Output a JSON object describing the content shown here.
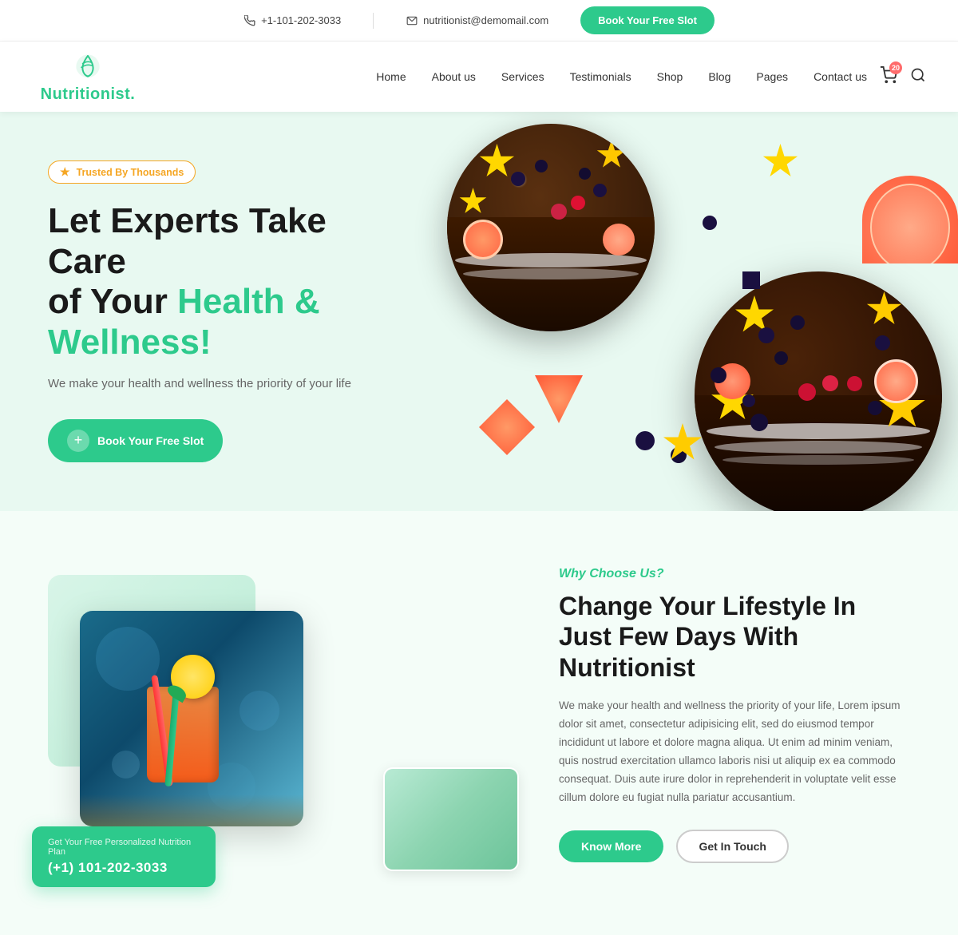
{
  "topbar": {
    "phone": "+1-101-202-3033",
    "email": "nutritionist@demomail.com",
    "book_btn": "Book Your Free Slot"
  },
  "logo": {
    "name": "Nutritionist.",
    "dot_color": "#2dca8c"
  },
  "nav": {
    "items": [
      {
        "label": "Home",
        "href": "#"
      },
      {
        "label": "About us",
        "href": "#"
      },
      {
        "label": "Services",
        "href": "#"
      },
      {
        "label": "Testimonials",
        "href": "#"
      },
      {
        "label": "Shop",
        "href": "#"
      },
      {
        "label": "Blog",
        "href": "#"
      },
      {
        "label": "Pages",
        "href": "#"
      },
      {
        "label": "Contact us",
        "href": "#"
      }
    ],
    "cart_count": "20"
  },
  "hero": {
    "badge_text": "Trusted By Thousands",
    "heading_line1": "Let Experts Take Care",
    "heading_line2_plain": "of Your ",
    "heading_line2_highlight": "Health & Wellness!",
    "subtext": "We make your health and wellness the priority of your life",
    "cta_btn": "Book Your Free Slot"
  },
  "why_section": {
    "label": "Why Choose Us?",
    "heading_line1": "Change Your Lifestyle In",
    "heading_line2": "Just Few Days With Nutritionist",
    "body": "We make your health and wellness the priority of your life, Lorem ipsum dolor sit amet, consectetur adipisicing elit, sed do eiusmod tempor incididunt ut labore et dolore magna aliqua. Ut enim ad minim veniam, quis nostrud exercitation ullamco laboris nisi ut aliquip ex ea commodo consequat. Duis aute irure dolor in reprehenderit in voluptate velit esse cillum dolore eu fugiat nulla pariatur accusantium.",
    "know_more_btn": "Know More",
    "get_in_touch_btn": "Get In Touch"
  },
  "callout": {
    "label": "Get Your Free Personalized Nutrition Plan",
    "phone": "(+1) 101-202-3033"
  },
  "colors": {
    "green": "#2dca8c",
    "orange": "#f5a623",
    "dark": "#1a1a1a",
    "hero_bg": "#e8f9f1"
  }
}
